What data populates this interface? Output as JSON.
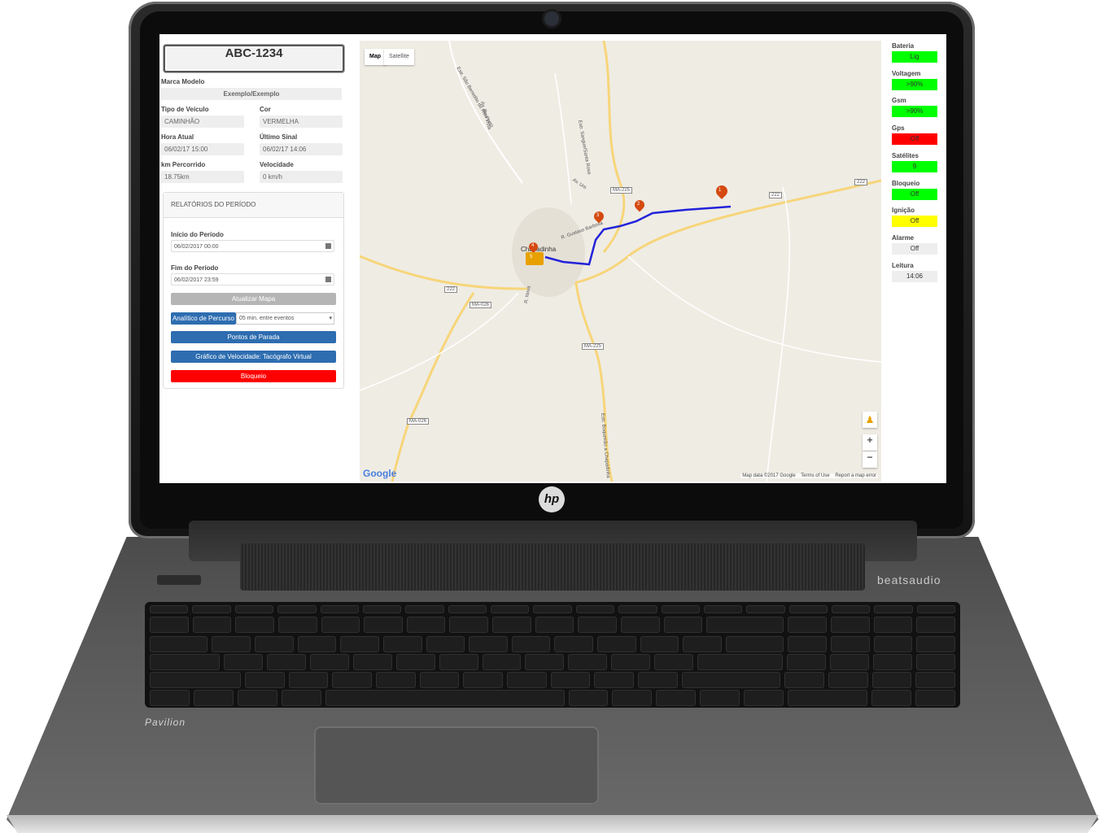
{
  "vehicle": {
    "plate": "ABC-1234",
    "brand_model_label": "Marca Modelo",
    "brand_model_value": "Exemplo/Exemplo",
    "type_label": "Tipo de Veículo",
    "type_value": "CAMINHÃO",
    "color_label": "Cor",
    "color_value": "VERMELHA",
    "current_time_label": "Hora Atual",
    "current_time_value": "06/02/17 15:00",
    "last_signal_label": "Último Sinal",
    "last_signal_value": "06/02/17 14:06",
    "km_label": "km Percorrido",
    "km_value": "18.75km",
    "speed_label": "Velocidade",
    "speed_value": "0 km/h"
  },
  "reports": {
    "title": "RELATÓRIOS DO PERÍODO",
    "start_label": "Início do Período",
    "start_value": "06/02/2017 00:00",
    "end_label": "Fim do Período",
    "end_value": "06/02/2017 23:59",
    "update_map": "Atualizar Mapa",
    "route_analysis": "Analítico de Percurso",
    "interval_value": "05 min. entre eventos",
    "stop_points": "Pontos de Parada",
    "speed_chart": "Gráfico de Velocidade: Tacógrafo Virtual",
    "block": "Bloqueio"
  },
  "map": {
    "tab_map": "Map",
    "tab_satellite": "Satellite",
    "city_label": "Chapadinha",
    "road_labels": [
      "MA-225",
      "222",
      "222",
      "222",
      "MA-026",
      "MA-225",
      "MA-026"
    ],
    "street_labels": [
      "Estr. São Benedito do Rio Preto",
      "Av. Boa Vista",
      "Estr. Sangue/Santa Rosa",
      "Av. Um",
      "R. Gustavo Barbosa",
      "R. Nova",
      "Estr. Boqueirão a Chapadinha"
    ],
    "marker_labels": [
      "1",
      "2",
      "3",
      "4",
      "5"
    ],
    "zoom_in": "+",
    "zoom_out": "−",
    "google": "Google",
    "map_data": "Map data ©2017 Google",
    "terms": "Terms of Use",
    "report": "Report a map error"
  },
  "status": {
    "items": [
      {
        "label": "Bateria",
        "value": "Lig",
        "color": "#00ff00"
      },
      {
        "label": "Voltagem",
        "value": ">90%",
        "color": "#00ff00"
      },
      {
        "label": "Gsm",
        "value": ">90%",
        "color": "#00ff00"
      },
      {
        "label": "Gps",
        "value": "Off",
        "color": "#ff0000"
      },
      {
        "label": "Satélites",
        "value": "9",
        "color": "#00ff00"
      },
      {
        "label": "Bloqueio",
        "value": "Off",
        "color": "#00ff00"
      },
      {
        "label": "Ignição",
        "value": "Off",
        "color": "#ffff00"
      },
      {
        "label": "Alarme",
        "value": "Off",
        "color": "#eeeeee"
      },
      {
        "label": "Leitura",
        "value": "14:06",
        "color": "#eeeeee"
      }
    ]
  },
  "laptop": {
    "brand_logo": "hp",
    "audio_brand": "beatsaudio",
    "model": "Pavilion"
  },
  "colors": {
    "primary_button": "#2d6db0",
    "danger_button": "#ff0000",
    "disabled_button": "#b5b5b5",
    "route": "#2323d9",
    "marker": "#d44a10"
  }
}
